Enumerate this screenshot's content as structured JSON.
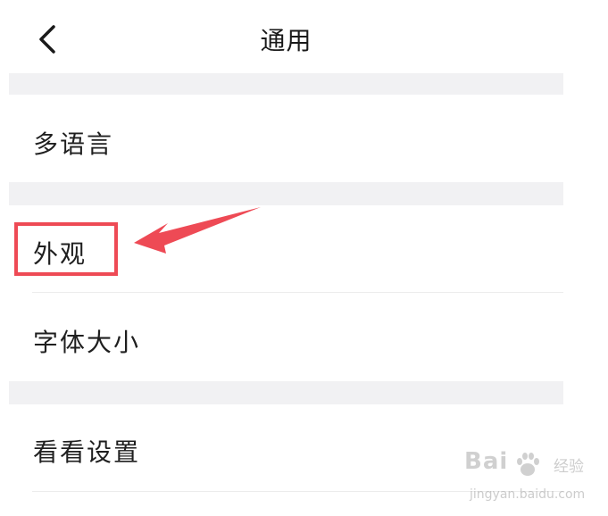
{
  "header": {
    "title": "通用"
  },
  "settings": {
    "items": [
      {
        "label": "多语言"
      },
      {
        "label": "外观"
      },
      {
        "label": "字体大小"
      },
      {
        "label": "看看设置"
      }
    ]
  },
  "watermark": {
    "brand": "Bai",
    "brand_cn": "经验",
    "url": "jingyan.baidu.com"
  },
  "colors": {
    "background": "#ffffff",
    "section_gap": "#f1f1f3",
    "divider": "#ececec",
    "annotation_red": "#ee4a55",
    "text": "#1a1a1a"
  },
  "icons": {
    "back": "chevron-left-icon",
    "annotation_arrow": "arrow-left-icon",
    "watermark_logo": "baidu-paw-icon"
  }
}
